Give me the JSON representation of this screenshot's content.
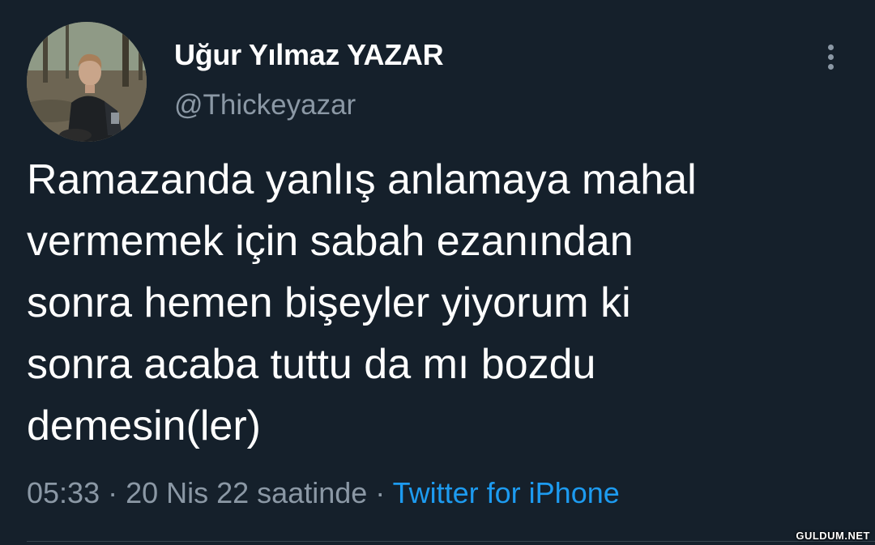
{
  "tweet": {
    "author": {
      "display_name": "Uğur Yılmaz YAZAR",
      "handle": "@Thickeyazar"
    },
    "text_lines": [
      "Ramazanda yanlış anlamaya mahal",
      "vermemek için sabah ezanından",
      "sonra hemen bişeyler yiyorum ki",
      "sonra acaba tuttu da mı bozdu",
      "demesin(ler)"
    ],
    "meta": {
      "time": "05:33",
      "separator": " · ",
      "date": "20 Nis 22 saatinde",
      "source": "Twitter for iPhone"
    },
    "more_icon": "more-vertical-icon"
  },
  "watermark": "GULDUM.NET",
  "colors": {
    "background": "#15202b",
    "primary_text": "#ffffff",
    "secondary_text": "#8b98a5",
    "link": "#1d9bf0",
    "divider": "#38444d"
  }
}
